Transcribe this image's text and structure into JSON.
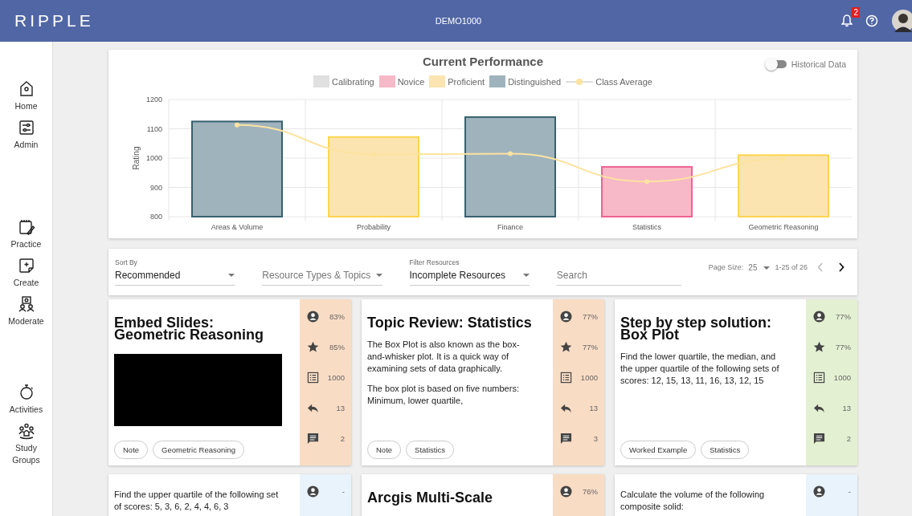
{
  "header": {
    "logo": "RIPPLE",
    "course": "DEMO1000",
    "notifications": "2"
  },
  "sidebar": {
    "groups": [
      [
        {
          "label": "Home",
          "kind": "home"
        },
        {
          "label": "Admin",
          "kind": "admin"
        }
      ],
      [
        {
          "label": "Practice",
          "kind": "practice"
        },
        {
          "label": "Create",
          "kind": "create"
        },
        {
          "label": "Moderate",
          "kind": "moderate"
        }
      ],
      [
        {
          "label": "Activities",
          "kind": "activities"
        },
        {
          "label": "Study Groups",
          "kind": "groups"
        }
      ]
    ]
  },
  "performance": {
    "title": "Current Performance",
    "historical_toggle": {
      "label": "Historical Data",
      "on": false
    },
    "chart_data": {
      "type": "bar",
      "stacked": true,
      "grid": true,
      "legend": "top",
      "ylabel": "Rating",
      "categories": [
        "Areas & Volume",
        "Probability",
        "Finance",
        "Statistics",
        "Geometric Reasoning"
      ],
      "ylim": [
        800,
        1200
      ],
      "yticks": [
        800,
        900,
        1000,
        1100,
        1200
      ],
      "series": [
        {
          "name": "Calibrating",
          "color": "#e0e0e0",
          "values": [
            null,
            null,
            null,
            null,
            null
          ]
        },
        {
          "name": "Novice",
          "color": "#f7b8c8",
          "values": [
            null,
            null,
            null,
            970,
            null
          ]
        },
        {
          "name": "Proficient",
          "color": "#fbe4b0",
          "values": [
            null,
            1072,
            null,
            null,
            1010
          ]
        },
        {
          "name": "Distinguished",
          "color": "#9fb3bd",
          "values": [
            1125,
            null,
            1140,
            null,
            null
          ]
        },
        {
          "name": "Class Average",
          "color": "#fde3a0",
          "type": "line",
          "marker": "o",
          "values": [
            1113,
            1013,
            1015,
            920,
            997
          ]
        }
      ]
    }
  },
  "filters": {
    "sort": {
      "label": "Sort By",
      "value": "Recommended"
    },
    "types": {
      "placeholder": "Resource Types & Topics"
    },
    "filter": {
      "label": "Filter Resources",
      "value": "Incomplete Resources"
    },
    "search": {
      "placeholder": "Search"
    },
    "page_size_label": "Page Size:",
    "page_size": "25",
    "range": "1-25 of 26",
    "prev_disabled": true,
    "next_disabled": false
  },
  "cards": [
    {
      "kind": "embed",
      "title": "Embed Slides: Geometric Reasoning",
      "tags": [
        "Note",
        "Geometric Reasoning"
      ],
      "color": "#f9dcc4",
      "stats": [
        {
          "kind": "user",
          "value": "83%"
        },
        {
          "kind": "star",
          "value": "85%"
        },
        {
          "kind": "list",
          "value": "1000"
        },
        {
          "kind": "reply",
          "value": "13"
        },
        {
          "kind": "comment",
          "value": "2"
        }
      ]
    },
    {
      "kind": "text",
      "title": "Topic Review: Statistics",
      "paragraphs": [
        "The Box Plot is also known as the box-and-whisker plot. It is a quick way of examining sets of data graphically.",
        "The box plot is based on five numbers: Minimum, lower quartile,"
      ],
      "tags": [
        "Note",
        "Statistics"
      ],
      "color": "#f9dcc4",
      "stats": [
        {
          "kind": "user",
          "value": "77%"
        },
        {
          "kind": "star",
          "value": "77%"
        },
        {
          "kind": "list",
          "value": "1000"
        },
        {
          "kind": "reply",
          "value": "13"
        },
        {
          "kind": "comment",
          "value": "3"
        }
      ]
    },
    {
      "kind": "text",
      "title": "Step by step solution: Box Plot",
      "paragraphs": [
        "Find the lower quartile, the median, and the upper quartile of the following sets of scores: 12, 15, 13, 11, 16, 13, 12, 15"
      ],
      "tags": [
        "Worked Example",
        "Statistics"
      ],
      "color": "#e4f0d2",
      "stats": [
        {
          "kind": "user",
          "value": "77%"
        },
        {
          "kind": "star",
          "value": "77%"
        },
        {
          "kind": "list",
          "value": "1000"
        },
        {
          "kind": "reply",
          "value": "13"
        },
        {
          "kind": "comment",
          "value": "2"
        }
      ]
    },
    {
      "kind": "text",
      "paragraphs": [
        "Find the upper quartile of the following set of scores: 5, 3, 6, 2, 4, 4, 6, 3"
      ],
      "color": "#e8f3fc",
      "stats": [
        {
          "kind": "user",
          "value": "-"
        }
      ]
    },
    {
      "kind": "text",
      "title": "Arcgis Multi-Scale",
      "color": "#f9dcc4",
      "stats": [
        {
          "kind": "user",
          "value": "76%"
        }
      ]
    },
    {
      "kind": "text",
      "paragraphs": [
        "Calculate the volume of the following composite solid:"
      ],
      "color": "#e8f3fc",
      "stats": [
        {
          "kind": "user",
          "value": "-"
        }
      ]
    }
  ]
}
